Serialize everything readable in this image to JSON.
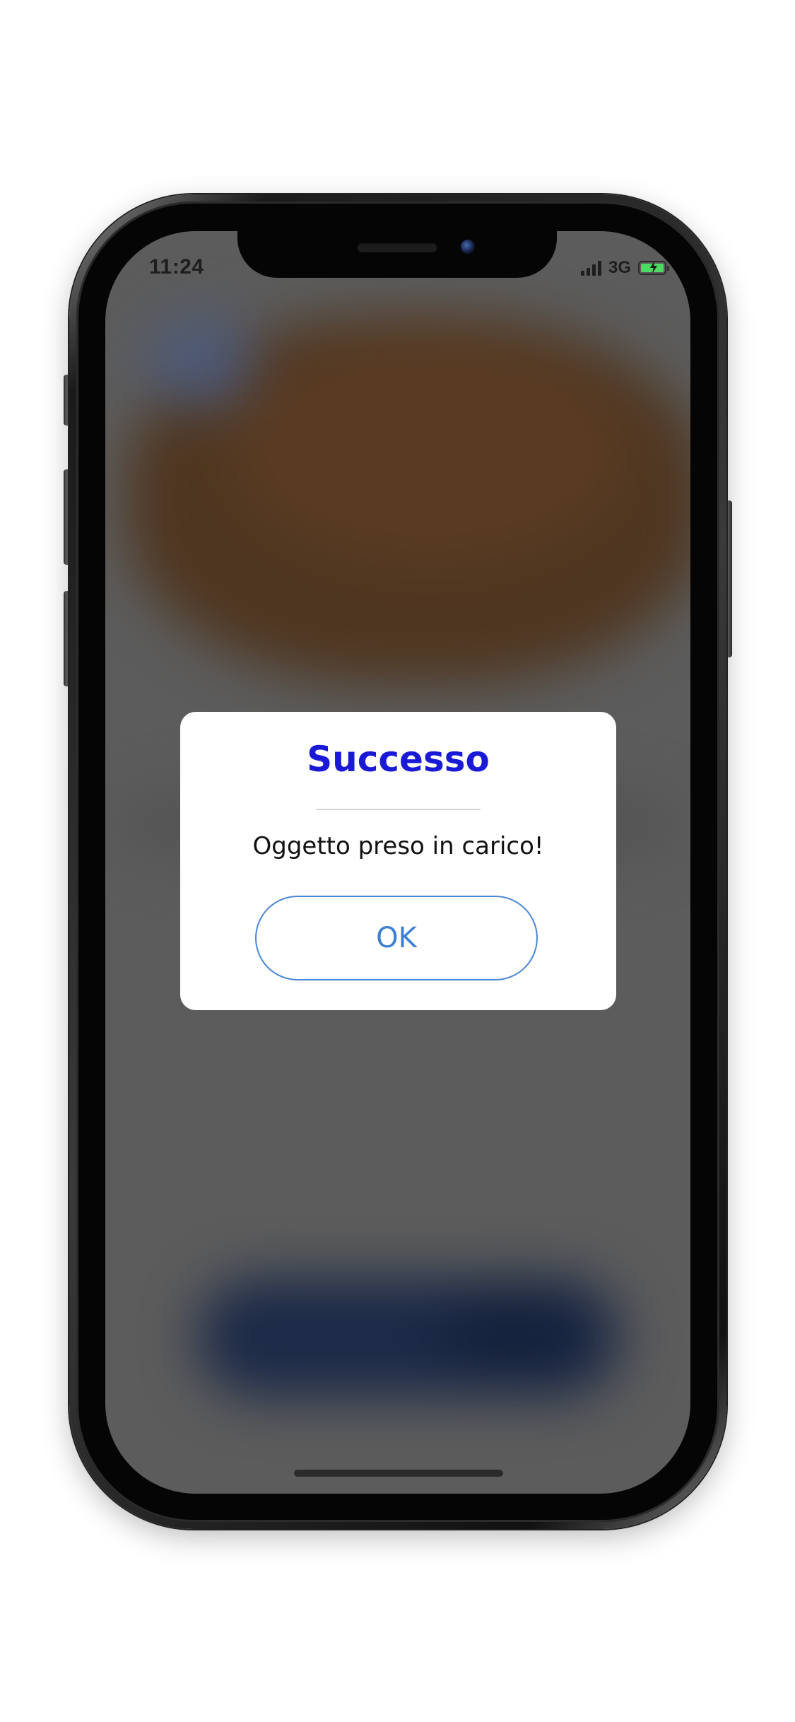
{
  "status_bar": {
    "time": "11:24",
    "network": "3G",
    "signal_icon": "cellular-signal-icon",
    "battery_icon": "battery-charging-icon",
    "battery_color": "#4cd964"
  },
  "dialog": {
    "title": "Successo",
    "message": "Oggetto preso in carico!",
    "ok_label": "OK",
    "title_color": "#1a1ad6",
    "button_color": "#3e7fd4"
  }
}
